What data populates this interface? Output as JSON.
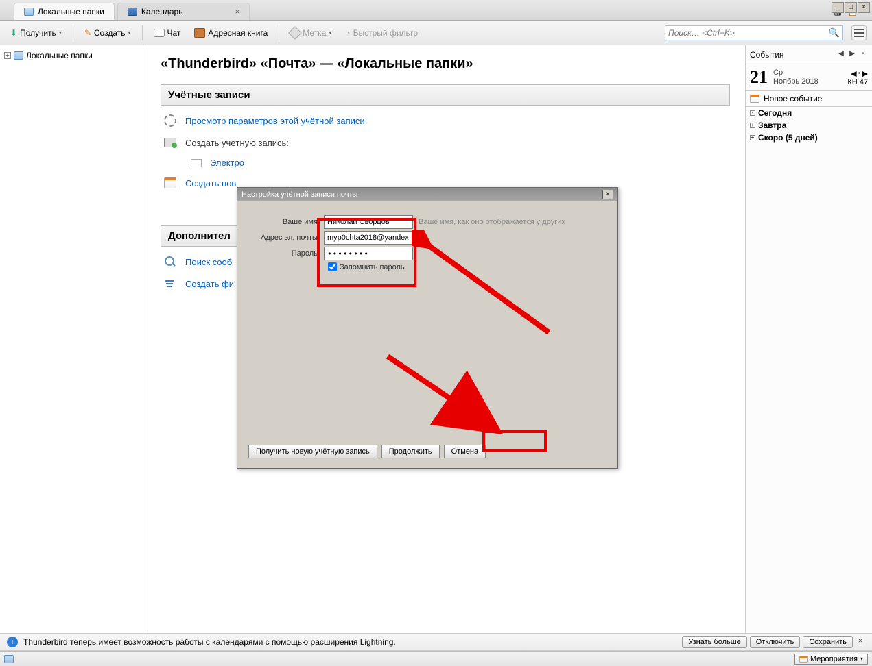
{
  "tabs": {
    "local_folders": "Локальные папки",
    "calendar": "Календарь"
  },
  "toolbar": {
    "get": "Получить",
    "create": "Создать",
    "chat": "Чат",
    "addressbook": "Адресная книга",
    "tag": "Метка",
    "quickfilter": "Быстрый фильтр",
    "search_placeholder": "Поиск… <Ctrl+K>"
  },
  "folders": {
    "local": "Локальные папки"
  },
  "content": {
    "title": "«Thunderbird» «Почта» — «Локальные папки»",
    "section_accounts": "Учётные записи",
    "view_settings": "Просмотр параметров этой учётной записи",
    "create_account": "Создать учётную запись:",
    "email_option": "Электро",
    "create_new": "Создать нов",
    "section_extra": "Дополнител",
    "search_msgs": "Поиск сооб",
    "create_fil": "Создать фи"
  },
  "dialog": {
    "title": "Настройка учётной записи почты",
    "name_label": "Ваше имя:",
    "name_value": "Николай Сворцов",
    "name_hint": "Ваше имя, как оно отображается у других",
    "email_label": "Адрес эл. почты:",
    "email_value": "myp0chta2018@yandex",
    "password_label": "Пароль:",
    "password_value": "••••••••",
    "remember": "Запомнить пароль",
    "get_new": "Получить новую учётную запись",
    "continue": "Продолжить",
    "cancel": "Отмена"
  },
  "calendar": {
    "header": "События",
    "day_num": "21",
    "weekday": "Ср",
    "month_year": "Ноябрь 2018",
    "week": "КН 47",
    "new_event": "Новое событие",
    "today": "Сегодня",
    "tomorrow": "Завтра",
    "soon": "Скоро (5 дней)"
  },
  "infobar": {
    "text": "Thunderbird теперь имеет возможность работы с календарями с помощью расширения Lightning.",
    "learn": "Узнать больше",
    "disable": "Отключить",
    "keep": "Сохранить"
  },
  "statusbar": {
    "events": "Мероприятия"
  }
}
